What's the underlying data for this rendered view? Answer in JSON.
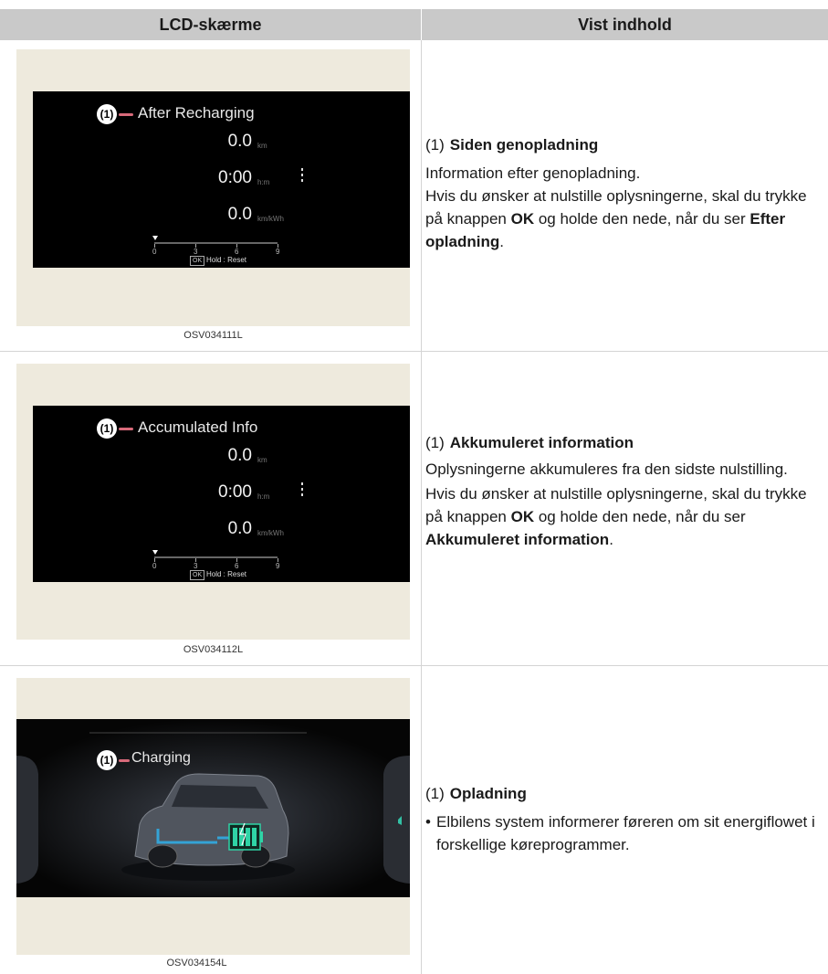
{
  "header": {
    "col1": "LCD-skærme",
    "col2": "Vist indhold"
  },
  "rows": [
    {
      "screen": {
        "badge": "(1)",
        "title": "After Recharging",
        "values": [
          {
            "value": "0.0",
            "unit": "km"
          },
          {
            "value": "0:00",
            "unit": "h:m"
          },
          {
            "value": "0.0",
            "unit": "km/kWh"
          }
        ],
        "scale_ticks": [
          "0",
          "3",
          "6",
          "9"
        ],
        "ok": "OK",
        "hold": "Hold : Reset"
      },
      "caption": "OSV034111L",
      "desc": {
        "num": "(1)",
        "title": "Siden genopladning",
        "line1": "Information efter genopladning.",
        "p2_a": "Hvis du ønsker at nulstille oplysningerne, skal du trykke på knappen ",
        "p2_b": "OK",
        "p2_c": " og holde den nede, når du ser ",
        "p2_d": "Efter opladning",
        "p2_e": "."
      }
    },
    {
      "screen": {
        "badge": "(1)",
        "title": "Accumulated Info",
        "values": [
          {
            "value": "0.0",
            "unit": "km"
          },
          {
            "value": "0:00",
            "unit": "h:m"
          },
          {
            "value": "0.0",
            "unit": "km/kWh"
          }
        ],
        "scale_ticks": [
          "0",
          "3",
          "6",
          "9"
        ],
        "ok": "OK",
        "hold": "Hold : Reset"
      },
      "caption": "OSV034112L",
      "desc": {
        "num": "(1)",
        "title": "Akkumuleret information",
        "line1": "Oplysningerne akkumuleres fra den sidste nulstilling.",
        "p2_a": "Hvis du ønsker at nulstille oplysningerne, skal du trykke på knappen ",
        "p2_b": "OK",
        "p2_c": " og holde den nede, når du ser ",
        "p2_d": "Akkumuleret information",
        "p2_e": "."
      }
    },
    {
      "screen": {
        "badge": "(1)",
        "title": "Charging"
      },
      "caption": "OSV034154L",
      "desc": {
        "num": "(1)",
        "title": "Opladning",
        "bullet_symbol": "•",
        "bullet": "Elbilens system informerer føreren om sit energiflowet i forskellige køreprogrammer."
      }
    }
  ]
}
